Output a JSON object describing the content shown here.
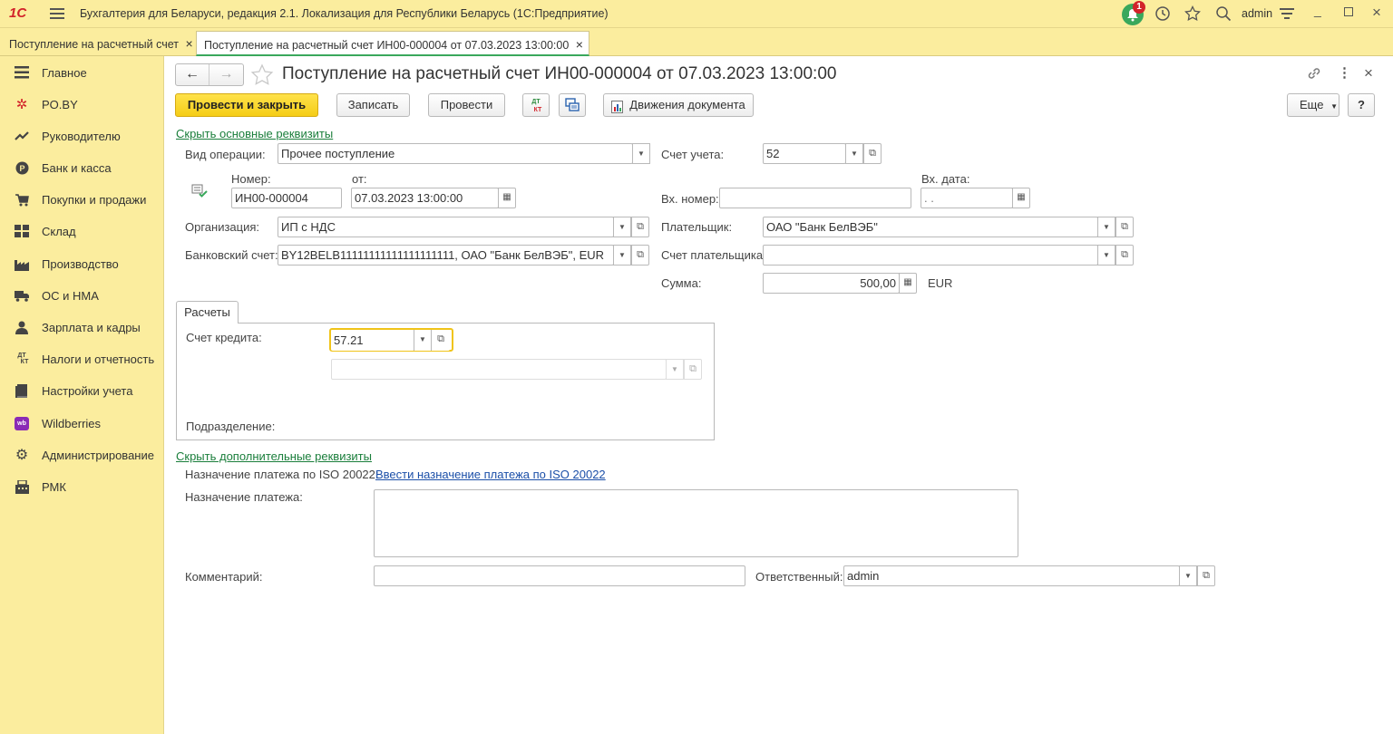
{
  "app": {
    "logo": "1С",
    "title": "Бухгалтерия для Беларуси, редакция 2.1. Локализация для Республики Беларусь  (1С:Предприятие)",
    "notification_count": "1",
    "user": "admin"
  },
  "tabs": [
    {
      "label": "Поступление на расчетный счет",
      "close": "×"
    },
    {
      "label": "Поступление на расчетный счет ИН00-000004 от 07.03.2023 13:00:00",
      "close": "×"
    }
  ],
  "sidebar": {
    "items": [
      {
        "label": "Главное",
        "icon": "menu-icon"
      },
      {
        "label": "PO.BY",
        "icon": "sparkle-icon"
      },
      {
        "label": "Руководителю",
        "icon": "trend-icon"
      },
      {
        "label": "Банк и касса",
        "icon": "coin-icon"
      },
      {
        "label": "Покупки и продажи",
        "icon": "cart-icon"
      },
      {
        "label": "Склад",
        "icon": "warehouse-icon"
      },
      {
        "label": "Производство",
        "icon": "factory-icon"
      },
      {
        "label": "ОС и НМА",
        "icon": "truck-icon"
      },
      {
        "label": "Зарплата и кадры",
        "icon": "person-icon"
      },
      {
        "label": "Налоги и отчетность",
        "icon": "dt-kt-icon"
      },
      {
        "label": "Настройки учета",
        "icon": "book-icon"
      },
      {
        "label": "Wildberries",
        "icon": "wb-icon"
      },
      {
        "label": "Администрирование",
        "icon": "gear-icon"
      },
      {
        "label": "РМК",
        "icon": "register-icon"
      }
    ]
  },
  "doc": {
    "title": "Поступление на расчетный счет ИН00-000004 от 07.03.2023 13:00:00",
    "toolbar": {
      "post_close": "Провести и закрыть",
      "write": "Записать",
      "post": "Провести",
      "movements": "Движения документа",
      "more": "Еще",
      "help": "?"
    },
    "hide_main_link": "Скрыть основные реквизиты",
    "hide_extra_link": "Скрыть дополнительные реквизиты",
    "fields": {
      "op_type_label": "Вид операции:",
      "op_type_value": "Прочее поступление",
      "account_label": "Счет учета:",
      "account_value": "52",
      "number_label": "Номер:",
      "number_value": "ИН00-000004",
      "date_label": "от:",
      "date_value": "07.03.2023 13:00:00",
      "in_number_label": "Вх. номер:",
      "in_number_value": "",
      "in_date_label": "Вх. дата:",
      "in_date_value": " .  .",
      "org_label": "Организация:",
      "org_value": "ИП с НДС",
      "payer_label": "Плательщик:",
      "payer_value": "ОАО \"Банк БелВЭБ\"",
      "bank_account_label": "Банковский счет:",
      "bank_account_value": "BY12BELB11111111111111111111, ОАО \"Банк БелВЭБ\", EUR",
      "payer_account_label": "Счет плательщика:",
      "payer_account_value": "",
      "sum_label": "Сумма:",
      "sum_value": "500,00",
      "currency": "EUR"
    },
    "calc": {
      "tab_label": "Расчеты",
      "credit_account_label": "Счет кредита:",
      "credit_account_value": "57.21",
      "subconto_value": "",
      "department_label": "Подразделение:"
    },
    "extra": {
      "iso_label": "Назначение платежа по ISO 20022:",
      "iso_link": "Ввести назначение платежа по ISO 20022",
      "purpose_label": "Назначение платежа:",
      "purpose_value": "",
      "comment_label": "Комментарий:",
      "comment_value": "",
      "responsible_label": "Ответственный:",
      "responsible_value": "admin"
    }
  }
}
